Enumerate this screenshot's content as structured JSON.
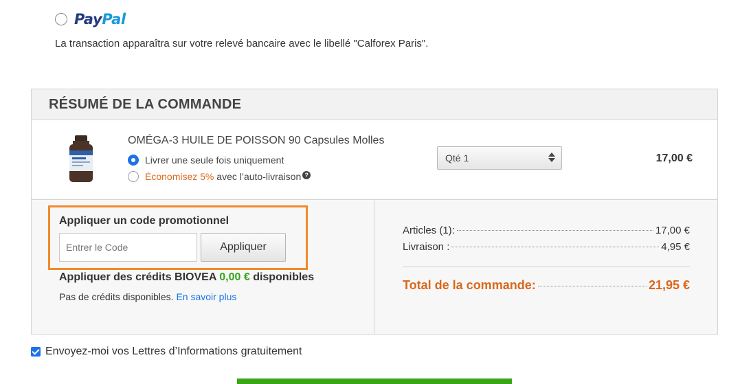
{
  "payment": {
    "paypal_logo_pay": "Pay",
    "paypal_logo_pal": "Pal",
    "bank_statement_note": "La transaction apparaîtra sur votre relevé bancaire avec le libellé \"Calforex Paris\"."
  },
  "summary": {
    "title": "RÉSUMÉ DE LA COMMANDE",
    "product": {
      "name": "OMÉGA-3 HUILE DE POISSON 90 Capsules Molles",
      "option_once": "Livrer une seule fois uniquement",
      "option_auto_save": "Économisez 5%",
      "option_auto_rest": "avec l’auto-livraison",
      "quantity_label": "Qté 1",
      "price": "17,00 €"
    },
    "promo": {
      "label": "Appliquer un code promotionnel",
      "placeholder": "Entrer le Code",
      "button": "Appliquer"
    },
    "credits": {
      "prefix": "Appliquer des crédits BIOVEA",
      "amount": "0,00 €",
      "suffix": "disponibles",
      "none_text": "Pas de crédits disponibles.",
      "learn_more": "En savoir plus"
    },
    "totals": {
      "articles_label": "Articles (1):",
      "articles_value": "17,00 €",
      "shipping_label": "Livraison :",
      "shipping_value": "4,95 €",
      "total_label": "Total de la commande:",
      "total_value": "21,95 €"
    }
  },
  "newsletter": {
    "label": "Envoyez-moi vos Lettres d’Informations gratuitement",
    "checked": true
  },
  "colors": {
    "accent_blue": "#1a73e8",
    "orange": "#d9681c",
    "promo_border": "#f08a2c",
    "green": "#35a417"
  }
}
